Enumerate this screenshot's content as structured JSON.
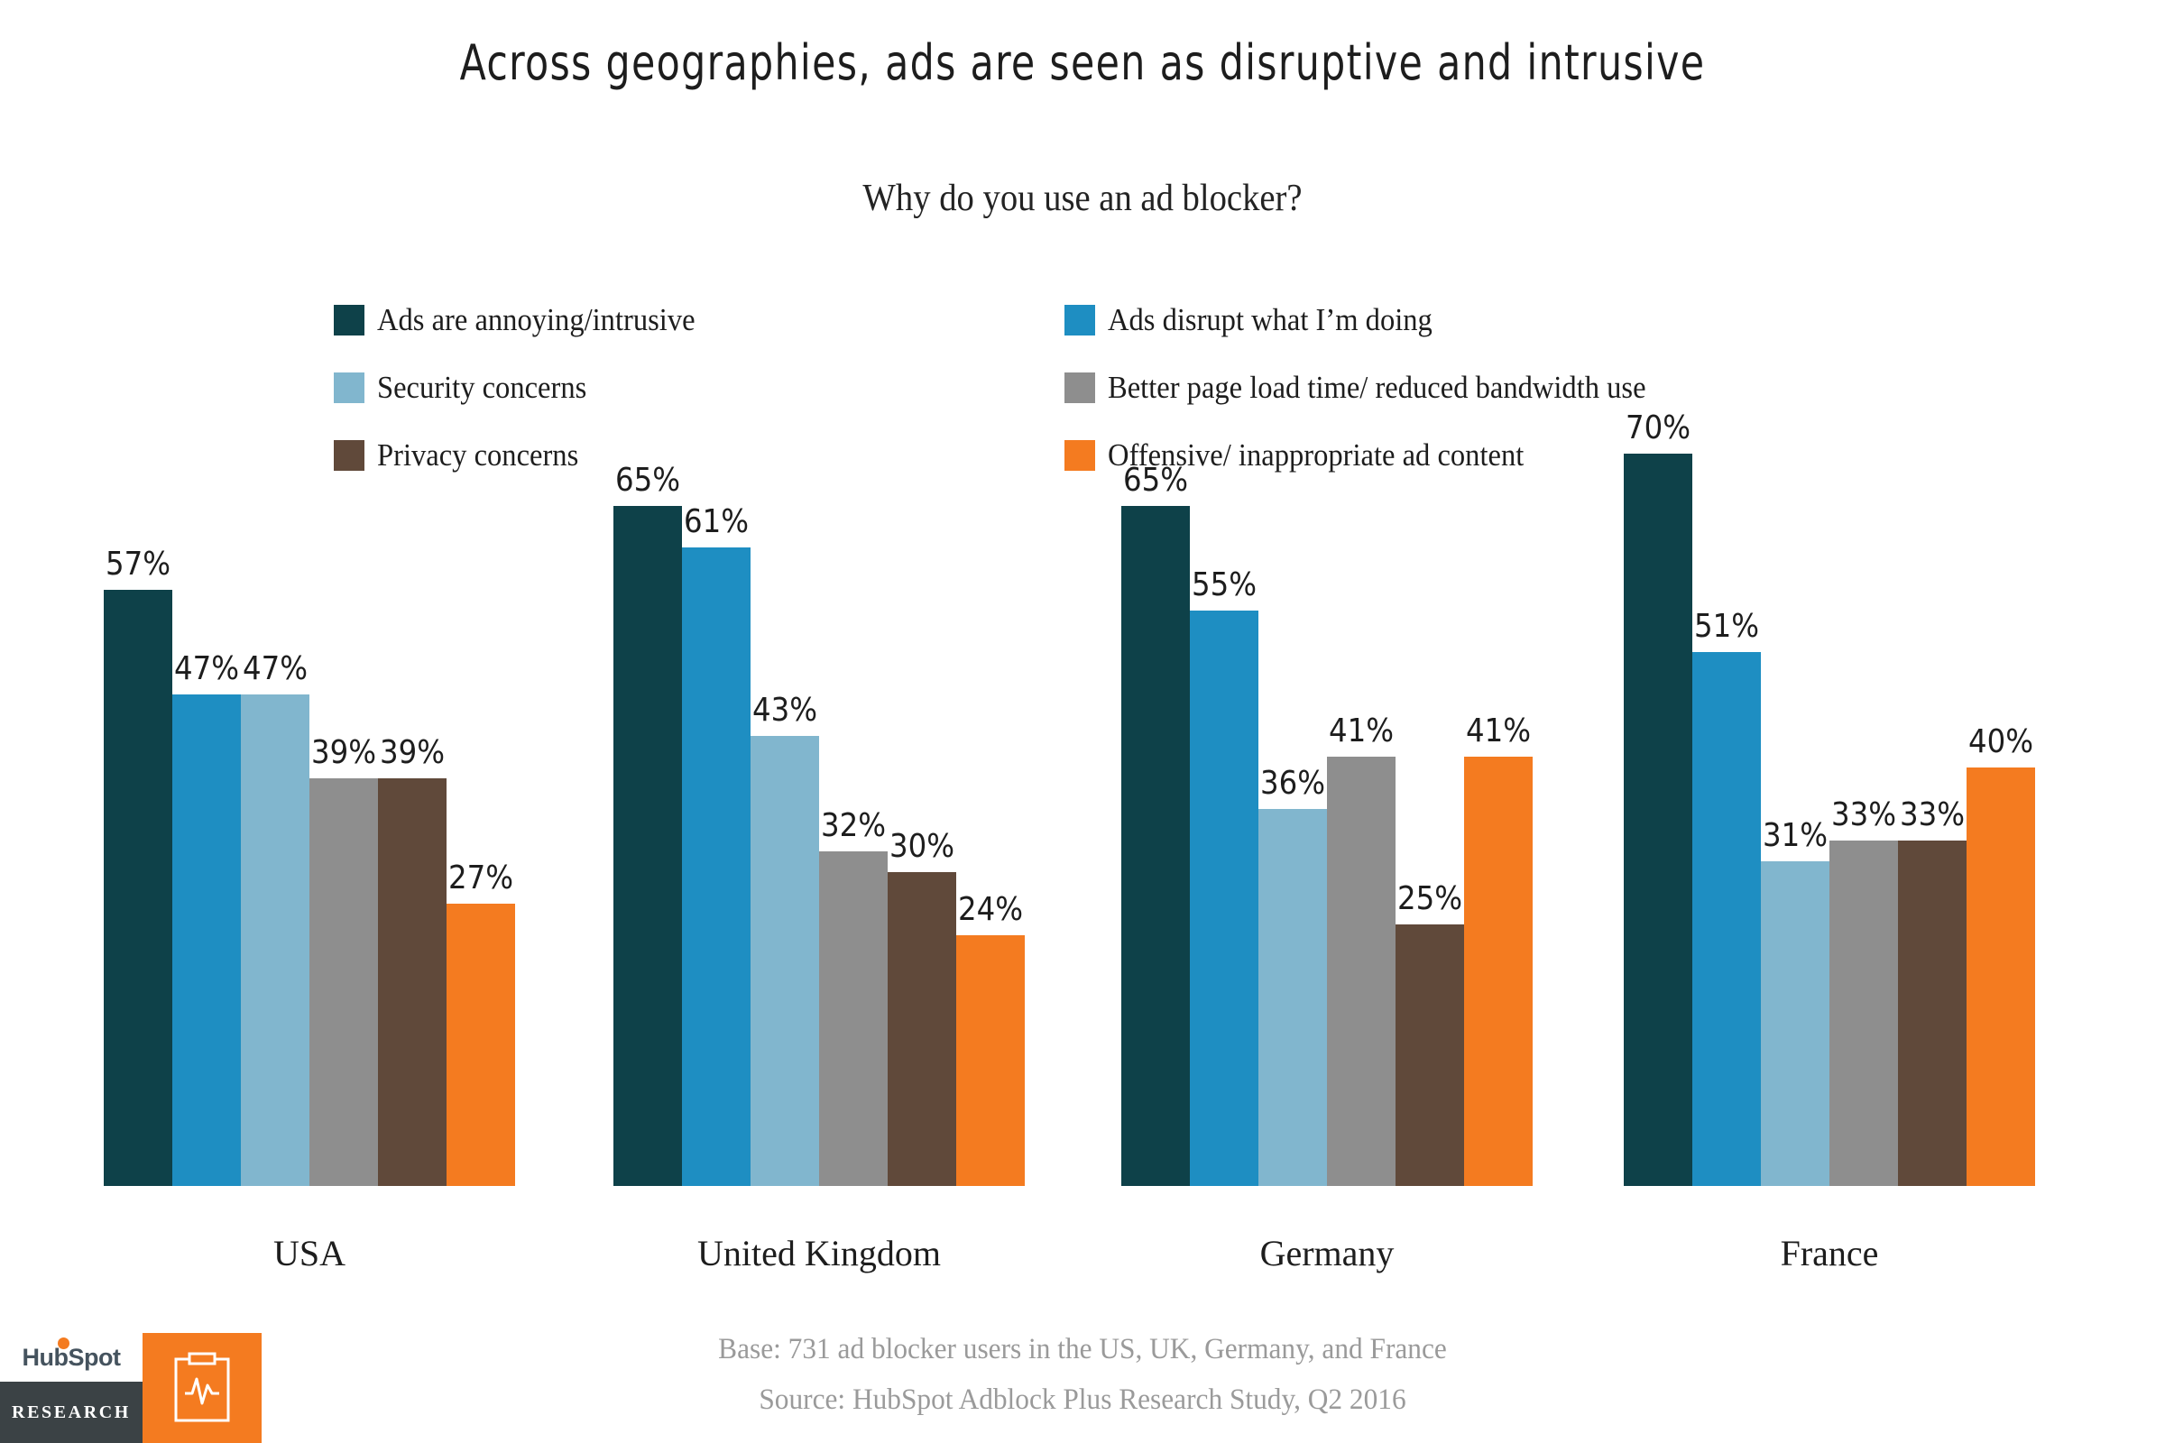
{
  "title": "Across geographies, ads are seen as disruptive and intrusive",
  "subtitle": "Why do you use an ad blocker?",
  "legend": [
    {
      "label": "Ads are annoying/intrusive",
      "color": "#0E4149"
    },
    {
      "label": "Ads disrupt what I’m doing",
      "color": "#1E8EC2"
    },
    {
      "label": "Security concerns",
      "color": "#81B6CE"
    },
    {
      "label": "Better page load time/ reduced bandwidth use",
      "color": "#8E8E8E"
    },
    {
      "label": "Privacy concerns",
      "color": "#60493A"
    },
    {
      "label": "Offensive/ inappropriate ad content",
      "color": "#F47B20"
    }
  ],
  "footer": {
    "base": "Base: 731 ad blocker users in the US, UK, Germany, and France",
    "source": "Source: HubSpot Adblock Plus Research Study, Q2 2016"
  },
  "logo": {
    "brand": "HubSpot",
    "division": "RESEARCH",
    "accent_color": "#F47B20",
    "dark_color": "#3B4245",
    "icon": "clipboard-pulse-icon"
  },
  "chart_data": {
    "type": "bar",
    "title": "Across geographies, ads are seen as disruptive and intrusive",
    "subtitle": "Why do you use an ad blocker?",
    "xlabel": "",
    "ylabel": "",
    "ylim": [
      0,
      78
    ],
    "grid": false,
    "legend_position": "top",
    "value_labels": true,
    "value_suffix": "%",
    "categories": [
      "USA",
      "United Kingdom",
      "Germany",
      "France"
    ],
    "series": [
      {
        "name": "Ads are annoying/intrusive",
        "color": "#0E4149",
        "values": [
          57,
          65,
          65,
          70
        ]
      },
      {
        "name": "Ads disrupt what I’m doing",
        "color": "#1E8EC2",
        "values": [
          47,
          61,
          55,
          51
        ]
      },
      {
        "name": "Security concerns",
        "color": "#81B6CE",
        "values": [
          47,
          43,
          36,
          31
        ]
      },
      {
        "name": "Better page load time/ reduced bandwidth use",
        "color": "#8E8E8E",
        "values": [
          39,
          32,
          41,
          33
        ]
      },
      {
        "name": "Privacy concerns",
        "color": "#60493A",
        "values": [
          39,
          30,
          25,
          33
        ]
      },
      {
        "name": "Offensive/ inappropriate ad content",
        "color": "#F47B20",
        "values": [
          27,
          24,
          41,
          40
        ]
      }
    ],
    "groups": [
      {
        "category": "USA",
        "bars": [
          {
            "series": "Ads are annoying/intrusive",
            "value": 57,
            "label": "57%",
            "color": "#0E4149"
          },
          {
            "series": "Ads disrupt what I’m doing",
            "value": 47,
            "label": "47%",
            "color": "#1E8EC2"
          },
          {
            "series": "Security concerns",
            "value": 47,
            "label": "47%",
            "color": "#81B6CE"
          },
          {
            "series": "Better page load time/ reduced bandwidth use",
            "value": 39,
            "label": "39%",
            "color": "#8E8E8E"
          },
          {
            "series": "Privacy concerns",
            "value": 39,
            "label": "39%",
            "color": "#60493A"
          },
          {
            "series": "Offensive/ inappropriate ad content",
            "value": 27,
            "label": "27%",
            "color": "#F47B20"
          }
        ]
      },
      {
        "category": "United Kingdom",
        "bars": [
          {
            "series": "Ads are annoying/intrusive",
            "value": 65,
            "label": "65%",
            "color": "#0E4149"
          },
          {
            "series": "Ads disrupt what I’m doing",
            "value": 61,
            "label": "61%",
            "color": "#1E8EC2"
          },
          {
            "series": "Security concerns",
            "value": 43,
            "label": "43%",
            "color": "#81B6CE"
          },
          {
            "series": "Better page load time/ reduced bandwidth use",
            "value": 32,
            "label": "32%",
            "color": "#8E8E8E"
          },
          {
            "series": "Privacy concerns",
            "value": 30,
            "label": "30%",
            "color": "#60493A"
          },
          {
            "series": "Offensive/ inappropriate ad content",
            "value": 24,
            "label": "24%",
            "color": "#F47B20"
          }
        ]
      },
      {
        "category": "Germany",
        "bars": [
          {
            "series": "Ads are annoying/intrusive",
            "value": 65,
            "label": "65%",
            "color": "#0E4149"
          },
          {
            "series": "Ads disrupt what I’m doing",
            "value": 55,
            "label": "55%",
            "color": "#1E8EC2"
          },
          {
            "series": "Security concerns",
            "value": 36,
            "label": "36%",
            "color": "#81B6CE"
          },
          {
            "series": "Better page load time/ reduced bandwidth use",
            "value": 41,
            "label": "41%",
            "color": "#8E8E8E"
          },
          {
            "series": "Privacy concerns",
            "value": 25,
            "label": "25%",
            "color": "#60493A"
          },
          {
            "series": "Offensive/ inappropriate ad content",
            "value": 41,
            "label": "41%",
            "color": "#F47B20"
          }
        ]
      },
      {
        "category": "France",
        "bars": [
          {
            "series": "Ads are annoying/intrusive",
            "value": 70,
            "label": "70%",
            "color": "#0E4149"
          },
          {
            "series": "Ads disrupt what I’m doing",
            "value": 51,
            "label": "51%",
            "color": "#1E8EC2"
          },
          {
            "series": "Security concerns",
            "value": 31,
            "label": "31%",
            "color": "#81B6CE"
          },
          {
            "series": "Better page load time/ reduced bandwidth use",
            "value": 33,
            "label": "33%",
            "color": "#8E8E8E"
          },
          {
            "series": "Privacy concerns",
            "value": 33,
            "label": "33%",
            "color": "#60493A"
          },
          {
            "series": "Offensive/ inappropriate ad content",
            "value": 40,
            "label": "40%",
            "color": "#F47B20"
          }
        ]
      }
    ]
  }
}
